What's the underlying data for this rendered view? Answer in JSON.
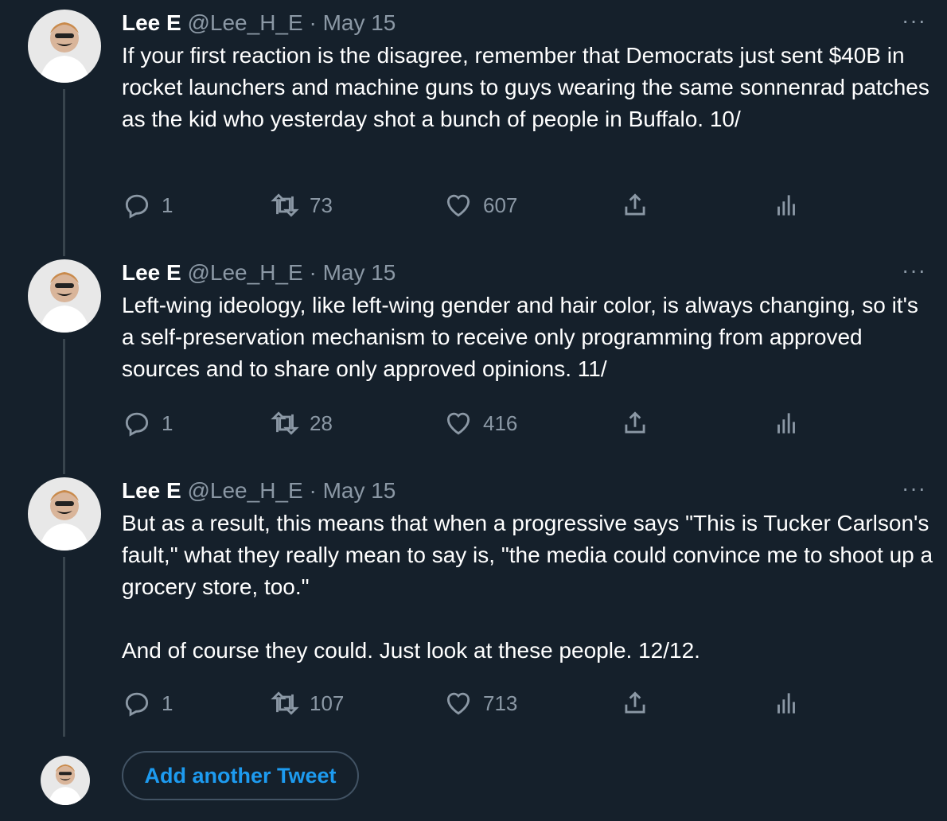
{
  "tweets": [
    {
      "author": "Lee E",
      "handle": "@Lee_H_E",
      "dot": "·",
      "date": "May 15",
      "text": "If your first reaction is the disagree, remember that Democrats just sent $40B in rocket launchers and machine guns to guys wearing the same sonnenrad patches as the kid who yesterday shot a bunch of people in Buffalo. 10/",
      "replies": "1",
      "retweets": "73",
      "likes": "607"
    },
    {
      "author": "Lee E",
      "handle": "@Lee_H_E",
      "dot": "·",
      "date": "May 15",
      "text": "Left-wing ideology, like left-wing gender and hair color, is always changing, so it's a self-preservation mechanism to receive only programming from approved sources and to share only approved opinions. 11/",
      "replies": "1",
      "retweets": "28",
      "likes": "416"
    },
    {
      "author": "Lee E",
      "handle": "@Lee_H_E",
      "dot": "·",
      "date": "May 15",
      "text": "But as a result, this means that when a progressive says \"This is Tucker Carlson's fault,\" what they really mean to say is, \"the media could convince me to shoot up a grocery store, too.\"\n\nAnd of course they could. Just look at these people. 12/12.",
      "replies": "1",
      "retweets": "107",
      "likes": "713"
    }
  ],
  "more_label": "···",
  "add_tweet_label": "Add another Tweet",
  "colors": {
    "background": "#15202b",
    "secondary_text": "#8b98a5",
    "accent": "#1d9bf0",
    "thread_line": "#38444d"
  },
  "icons": [
    "reply-icon",
    "retweet-icon",
    "like-icon",
    "share-icon",
    "analytics-icon",
    "more-icon"
  ]
}
